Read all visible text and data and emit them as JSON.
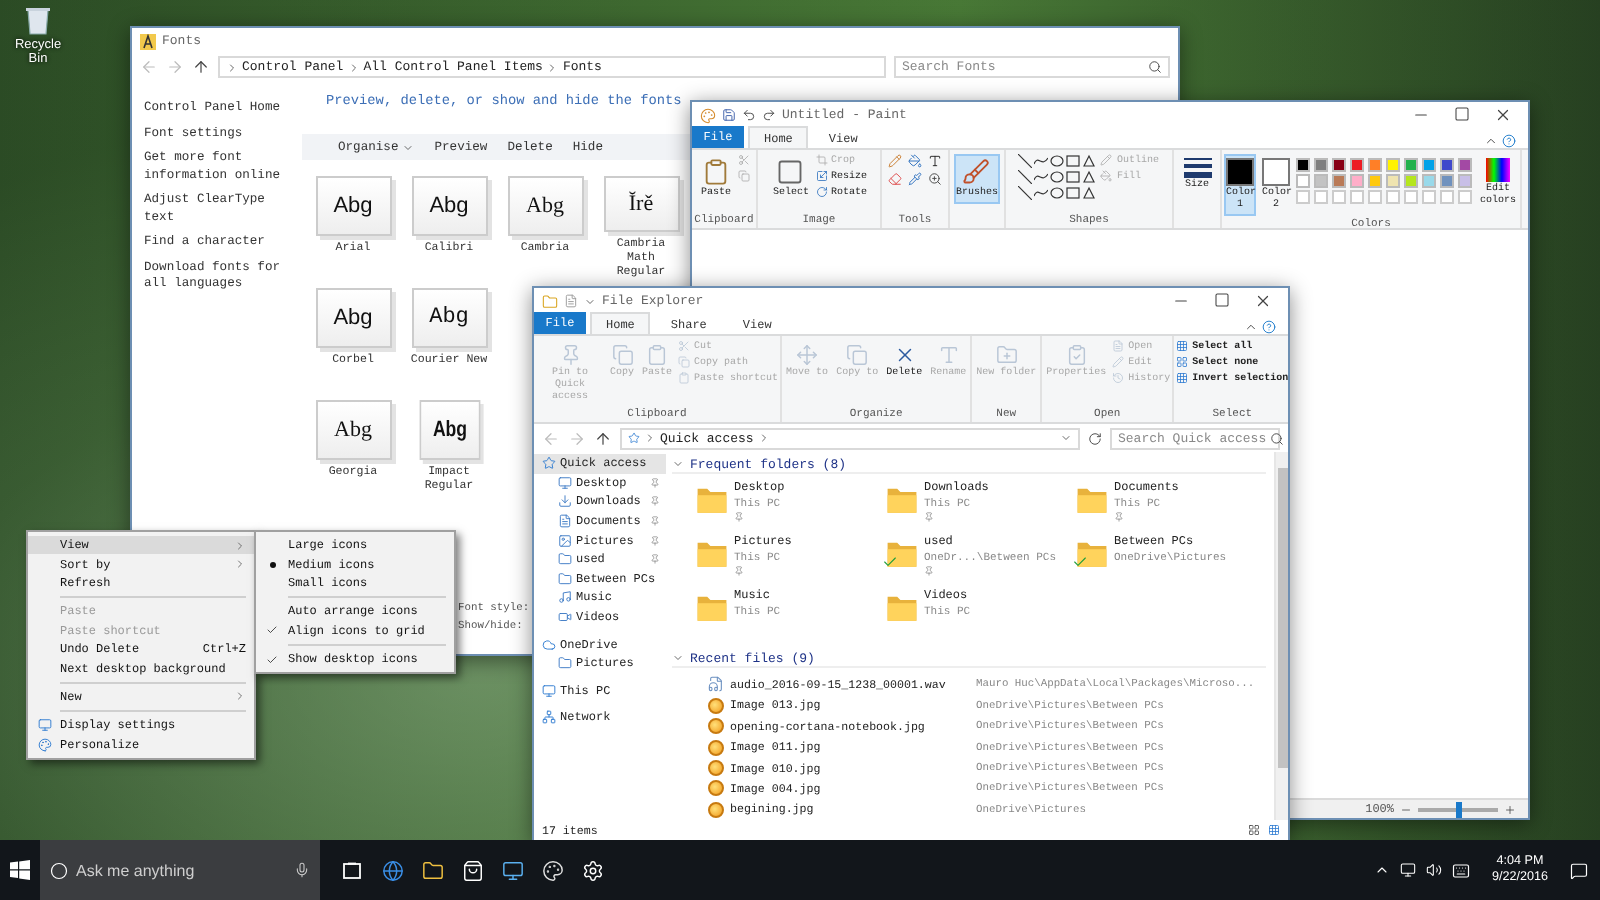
{
  "desktop": {
    "icon_label": "Recycle Bin"
  },
  "fonts_window": {
    "title": "Fonts",
    "address": [
      "Control Panel",
      "All Control Panel Items",
      "Fonts"
    ],
    "search": {
      "placeholder": "Search Fonts"
    },
    "links": [
      "Control Panel Home",
      "Font settings",
      "Get more font information online",
      "Adjust ClearType text",
      "Find a character",
      "Download fonts for all languages"
    ],
    "heading": "Preview, delete, or show and hide the fonts",
    "toolbar": [
      {
        "label": "Organise",
        "menu": true
      },
      {
        "label": "Preview",
        "menu": false
      },
      {
        "label": "Delete",
        "menu": false
      },
      {
        "label": "Hide",
        "menu": false
      }
    ],
    "font_rows": [
      [
        {
          "sample": "Abg",
          "name": "Arial",
          "kind": "sans"
        },
        {
          "sample": "Abg",
          "name": "Calibri",
          "kind": "sans"
        },
        {
          "sample": "Abg",
          "name": "Cambria",
          "kind": "serif"
        },
        {
          "sample": "Ĭrě",
          "name": "Cambria Math Regular",
          "kind": "serif"
        }
      ],
      [
        {
          "sample": "Abg",
          "name": "Corbel",
          "kind": "sans"
        },
        {
          "sample": "Abg",
          "name": "Courier New",
          "kind": "mono"
        }
      ],
      [
        {
          "sample": "Abg",
          "name": "Georgia",
          "kind": "serif"
        },
        {
          "sample": "Abg",
          "name": "Impact Regular",
          "kind": "heavy"
        }
      ]
    ],
    "details": [
      "Font style:",
      "Show/hide:"
    ]
  },
  "paint": {
    "title": "Untitled - Paint",
    "file_tab": "File",
    "tabs": [
      {
        "label": "Home",
        "selected": true
      },
      {
        "label": "View",
        "selected": false
      }
    ],
    "ribbon": {
      "clipboard": {
        "paste": "Paste",
        "label": "Clipboard"
      },
      "image": {
        "select": "Select",
        "crop": "Crop",
        "resize": "Resize",
        "rotate": "Rotate",
        "label": "Image"
      },
      "tools": {
        "label": "Tools"
      },
      "brushes": {
        "label": "Brushes",
        "selected": true
      },
      "shapes": {
        "outline": "Outline",
        "fill": "Fill",
        "label": "Shapes"
      },
      "size": {
        "label": "Size"
      },
      "colors": {
        "color1": {
          "label": "Color 1",
          "color": "#000000",
          "selected": true
        },
        "color2": {
          "label": "Color 2",
          "color": "#ffffff",
          "selected": false
        },
        "palette": [
          {
            "color": "#000000"
          },
          {
            "color": "#7f7f7f"
          },
          {
            "color": "#880015"
          },
          {
            "color": "#ed1c24"
          },
          {
            "color": "#ff7f27"
          },
          {
            "color": "#fff200"
          },
          {
            "color": "#22b14c"
          },
          {
            "color": "#00a2e8"
          },
          {
            "color": "#3f48cc"
          },
          {
            "color": "#a349a4"
          },
          {
            "color": "#ffffff"
          },
          {
            "color": "#c3c3c3"
          },
          {
            "color": "#b97a57"
          },
          {
            "color": "#ffaec9"
          },
          {
            "color": "#ffc90e"
          },
          {
            "color": "#efe4b0"
          },
          {
            "color": "#b5e61d"
          },
          {
            "color": "#99d9ea"
          },
          {
            "color": "#7092be"
          },
          {
            "color": "#c8bfe7"
          }
        ],
        "edit": "Edit colors",
        "label": "Colors"
      }
    },
    "status": {
      "zoom": {
        "reading": "100%",
        "level": 0.5
      }
    }
  },
  "explorer": {
    "title": "File Explorer",
    "file_tab": "File",
    "tabs": [
      {
        "label": "Home",
        "selected": true
      },
      {
        "label": "Share",
        "selected": false
      },
      {
        "label": "View",
        "selected": false
      }
    ],
    "ribbon": [
      {
        "label": "Clipboard",
        "buttons": [
          {
            "label": "Pin to Quick access",
            "kind": "large",
            "disabled": true
          },
          {
            "label": "Copy",
            "kind": "large",
            "disabled": true
          },
          {
            "label": "Paste",
            "kind": "large",
            "disabled": true
          },
          {
            "label": "Cut",
            "kind": "small",
            "disabled": true
          },
          {
            "label": "Copy path",
            "kind": "small",
            "disabled": true
          },
          {
            "label": "Paste shortcut",
            "kind": "small",
            "disabled": true
          }
        ]
      },
      {
        "label": "Organize",
        "buttons": [
          {
            "label": "Move to",
            "kind": "large",
            "disabled": true
          },
          {
            "label": "Copy to",
            "kind": "large",
            "disabled": true
          },
          {
            "label": "Delete",
            "kind": "large",
            "disabled": false
          },
          {
            "label": "Rename",
            "kind": "large",
            "disabled": true
          }
        ]
      },
      {
        "label": "New",
        "buttons": [
          {
            "label": "New folder",
            "kind": "large",
            "disabled": true
          }
        ]
      },
      {
        "label": "Open",
        "buttons": [
          {
            "label": "Properties",
            "kind": "large",
            "disabled": true
          },
          {
            "label": "Open",
            "kind": "small",
            "disabled": true
          },
          {
            "label": "Edit",
            "kind": "small",
            "disabled": true
          },
          {
            "label": "History",
            "kind": "small",
            "disabled": true
          }
        ]
      },
      {
        "label": "Select",
        "buttons": [
          {
            "label": "Select all",
            "kind": "small",
            "disabled": false
          },
          {
            "label": "Select none",
            "kind": "small",
            "disabled": false
          },
          {
            "label": "Invert selection",
            "kind": "small",
            "disabled": false
          }
        ]
      }
    ],
    "address": "Quick access",
    "search": {
      "placeholder": "Search Quick access"
    },
    "nav": [
      {
        "label": "Quick access",
        "selected": true,
        "children": [
          {
            "label": "Desktop",
            "pinned": true,
            "selected": false
          },
          {
            "label": "Downloads",
            "pinned": true,
            "selected": false
          },
          {
            "label": "Documents",
            "pinned": true,
            "selected": false
          },
          {
            "label": "Pictures",
            "pinned": true,
            "selected": false
          },
          {
            "label": "used",
            "pinned": true,
            "selected": false
          },
          {
            "label": "Between PCs",
            "pinned": false,
            "selected": false
          },
          {
            "label": "Music",
            "pinned": false,
            "selected": false
          },
          {
            "label": "Videos",
            "pinned": false,
            "selected": false
          }
        ]
      },
      {
        "label": "OneDrive",
        "selected": false,
        "children": [
          {
            "label": "Pictures",
            "pinned": false,
            "selected": false
          }
        ]
      },
      {
        "label": "This PC",
        "selected": false
      },
      {
        "label": "Network",
        "selected": false
      }
    ],
    "frequent": {
      "heading": "Frequent folders (8)",
      "folders": [
        {
          "name": "Desktop",
          "location": "This PC",
          "pinned": true,
          "synced": false
        },
        {
          "name": "Downloads",
          "location": "This PC",
          "pinned": true,
          "synced": false
        },
        {
          "name": "Documents",
          "location": "This PC",
          "pinned": true,
          "synced": false
        },
        {
          "name": "Pictures",
          "location": "This PC",
          "pinned": true,
          "synced": false
        },
        {
          "name": "used",
          "location": "OneDr...\\Between PCs",
          "pinned": true,
          "synced": true
        },
        {
          "name": "Between PCs",
          "location": "OneDrive\\Pictures",
          "pinned": false,
          "synced": true
        },
        {
          "name": "Music",
          "location": "This PC",
          "pinned": false,
          "synced": false
        },
        {
          "name": "Videos",
          "location": "This PC",
          "pinned": false,
          "synced": false
        }
      ]
    },
    "recent": {
      "heading": "Recent files (9)",
      "files": [
        {
          "name": "audio_2016-09-15_1238_00001.wav",
          "path": "Mauro Huc\\AppData\\Local\\Packages\\Microso...",
          "kind": "audio"
        },
        {
          "name": "Image 013.jpg",
          "path": "OneDrive\\Pictures\\Between PCs",
          "kind": "image"
        },
        {
          "name": "opening-cortana-notebook.jpg",
          "path": "OneDrive\\Pictures\\Between PCs",
          "kind": "image"
        },
        {
          "name": "Image 011.jpg",
          "path": "OneDrive\\Pictures\\Between PCs",
          "kind": "image"
        },
        {
          "name": "Image 010.jpg",
          "path": "OneDrive\\Pictures\\Between PCs",
          "kind": "image"
        },
        {
          "name": "Image 004.jpg",
          "path": "OneDrive\\Pictures\\Between PCs",
          "kind": "image"
        },
        {
          "name": "begining.jpg",
          "path": "OneDrive\\Pictures",
          "kind": "image"
        }
      ]
    },
    "status": "17 items"
  },
  "context_menu": {
    "groups": [
      [
        {
          "label": "View",
          "submenu": true,
          "selected": true,
          "disabled": false
        },
        {
          "label": "Sort by",
          "submenu": true,
          "selected": false,
          "disabled": false
        },
        {
          "label": "Refresh",
          "submenu": false,
          "selected": false,
          "disabled": false
        }
      ],
      [
        {
          "label": "Paste",
          "submenu": false,
          "selected": false,
          "disabled": true
        },
        {
          "label": "Paste shortcut",
          "submenu": false,
          "selected": false,
          "disabled": true
        },
        {
          "label": "Undo Delete",
          "shortcut": "Ctrl+Z",
          "submenu": false,
          "selected": false,
          "disabled": false
        },
        {
          "label": "Next desktop background",
          "submenu": false,
          "selected": false,
          "disabled": false
        }
      ],
      [
        {
          "label": "New",
          "submenu": true,
          "selected": false,
          "disabled": false
        }
      ],
      [
        {
          "label": "Display settings",
          "submenu": false,
          "selected": false,
          "disabled": false
        },
        {
          "label": "Personalize",
          "submenu": false,
          "selected": false,
          "disabled": false
        }
      ]
    ]
  },
  "view_menu": {
    "sizes": [
      {
        "label": "Large icons",
        "selected": false
      },
      {
        "label": "Medium icons",
        "selected": true
      },
      {
        "label": "Small icons",
        "selected": false
      }
    ],
    "arrange": [
      {
        "label": "Auto arrange icons",
        "checked": false
      },
      {
        "label": "Align icons to grid",
        "checked": true
      }
    ],
    "show": [
      {
        "label": "Show desktop icons",
        "checked": true
      }
    ]
  },
  "taskbar": {
    "search": {
      "placeholder": "Ask me anything"
    },
    "time": "4:04 PM",
    "date": "9/22/2016"
  }
}
